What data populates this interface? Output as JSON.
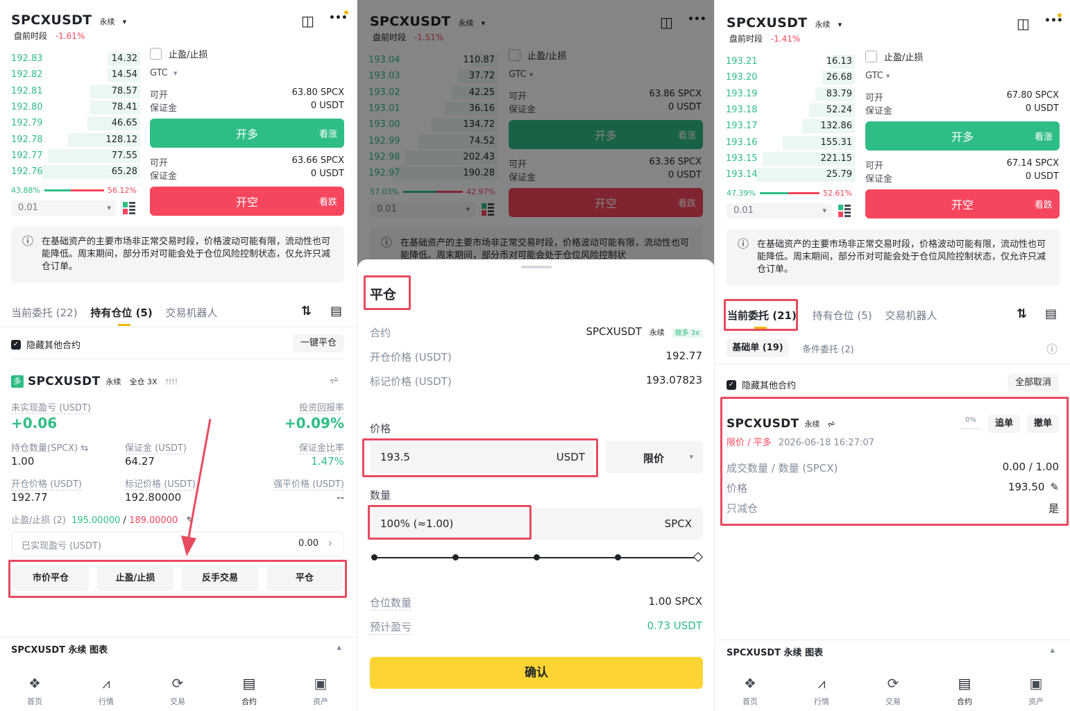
{
  "p1": {
    "symbol": "SPCXUSDT",
    "type": "永续",
    "session": "盘前时段",
    "change": "-1.61%",
    "orderbook": [
      [
        "192.83",
        "14.32"
      ],
      [
        "192.82",
        "14.54"
      ],
      [
        "192.81",
        "78.57"
      ],
      [
        "192.80",
        "78.41"
      ],
      [
        "192.79",
        "46.65"
      ],
      [
        "192.78",
        "128.12"
      ],
      [
        "192.77",
        "77.55"
      ],
      [
        "192.76",
        "65.28"
      ]
    ],
    "depth": [
      0.25,
      0.25,
      0.38,
      0.38,
      0.4,
      0.55,
      0.7,
      0.75
    ],
    "tpsl": "止盈/止损",
    "tif": "GTC",
    "open1_label": "可开",
    "open1_val": "63.80 SPCX",
    "margin1_label": "保证金",
    "margin1_val": "0 USDT",
    "long_btn": "开多",
    "long_sub": "看涨",
    "open2_label": "可开",
    "open2_val": "63.66 SPCX",
    "margin2_label": "保证金",
    "margin2_val": "0 USDT",
    "short_btn": "开空",
    "short_sub": "看跌",
    "ratio_buy": "43.88%",
    "ratio_sell": "56.12%",
    "ratio_buy_frac": 0.4388,
    "step": "0.01",
    "notice": "在基础资产的主要市场非正常交易时段，价格波动可能有限，流动性也可能降低。周末期间，部分币对可能会处于仓位风险控制状态，仅允许只减仓订单。",
    "tabs": [
      "当前委托 (22)",
      "持有仓位 (5)",
      "交易机器人"
    ],
    "hide_other": "隐藏其他合约",
    "close_all": "一键平仓",
    "pos": {
      "symbol": "SPCXUSDT",
      "type": "永续",
      "mode": "全仓 3X",
      "bars": "!!!!",
      "upnl_label": "未实现盈亏 (USDT)",
      "upnl": "+0.06",
      "roi_label": "投资回报率",
      "roi": "+0.09%",
      "qty_label": "持仓数量(SPCX) ⇆",
      "qty": "1.00",
      "margin_label": "保证金 (USDT)",
      "margin": "64.27",
      "mr_label": "保证金比率",
      "mr": "1.47%",
      "entry_label": "开仓价格 (USDT)",
      "entry": "192.77",
      "mark_label": "标记价格 (USDT)",
      "mark": "192.80000",
      "liq_label": "强平价格 (USDT)",
      "liq": "--",
      "tpsl_label": "止盈/止损 (2)",
      "tp": "195.00000",
      "sep": "/",
      "sl": "189.00000",
      "rpnl_label": "已实现盈亏 (USDT)",
      "rpnl": "0.00"
    },
    "actions": [
      "市价平仓",
      "止盈/止损",
      "反手交易",
      "平仓"
    ],
    "chart_bar": "SPCXUSDT 永续 图表"
  },
  "p2": {
    "symbol": "SPCXUSDT",
    "type": "永续",
    "session": "盘前时段",
    "change": "-1.51%",
    "orderbook": [
      [
        "193.04",
        "110.87"
      ],
      [
        "193.03",
        "37.72"
      ],
      [
        "193.02",
        "42.25"
      ],
      [
        "193.01",
        "36.16"
      ],
      [
        "193.00",
        "134.72"
      ],
      [
        "192.99",
        "74.52"
      ],
      [
        "192.98",
        "202.43"
      ],
      [
        "192.97",
        "190.28"
      ]
    ],
    "depth": [
      0.2,
      0.3,
      0.35,
      0.4,
      0.5,
      0.6,
      0.7,
      0.8
    ],
    "tpsl": "止盈/止损",
    "tif": "GTC",
    "open1_label": "可开",
    "open1_val": "63.86 SPCX",
    "margin1_label": "保证金",
    "margin1_val": "0 USDT",
    "long_btn": "开多",
    "long_sub": "看涨",
    "open2_label": "可开",
    "open2_val": "63.36 SPCX",
    "margin2_label": "保证金",
    "margin2_val": "0 USDT",
    "short_btn": "开空",
    "short_sub": "看跌",
    "ratio_buy": "57.03%",
    "ratio_sell": "42.97%",
    "ratio_buy_frac": 0.5703,
    "step": "0.01",
    "notice": "在基础资产的主要市场非正常交易时段，价格波动可能有限，流动性也可能降低。周末期间，部分币对可能会处于仓位风险控制状",
    "sheet": {
      "title": "平仓",
      "contract_label": "合约",
      "contract": "SPCXUSDT",
      "contract_type": "永续",
      "contract_tag": "做多 3x",
      "entry_label": "开仓价格 (USDT)",
      "entry": "192.77",
      "mark_label": "标记价格 (USDT)",
      "mark": "193.07823",
      "price_label": "价格",
      "price": "193.5",
      "price_unit": "USDT",
      "order_type": "限价",
      "qty_label": "数量",
      "qty": "100% (≈1.00)",
      "qty_unit": "SPCX",
      "pos_label": "仓位数量",
      "pos": "1.00 SPCX",
      "pnl_label": "预计盈亏",
      "pnl": "0.73 USDT",
      "confirm": "确认"
    }
  },
  "p3": {
    "symbol": "SPCXUSDT",
    "type": "永续",
    "session": "盘前时段",
    "change": "-1.41%",
    "orderbook": [
      [
        "193.21",
        "16.13"
      ],
      [
        "193.20",
        "26.68"
      ],
      [
        "193.19",
        "83.79"
      ],
      [
        "193.18",
        "52.24"
      ],
      [
        "193.17",
        "132.86"
      ],
      [
        "193.16",
        "155.31"
      ],
      [
        "193.15",
        "221.15"
      ],
      [
        "193.14",
        "25.79"
      ]
    ],
    "depth": [
      0.2,
      0.25,
      0.3,
      0.35,
      0.4,
      0.55,
      0.7,
      0.75
    ],
    "tpsl": "止盈/止损",
    "tif": "GTC",
    "open1_label": "可开",
    "open1_val": "67.80 SPCX",
    "margin1_label": "保证金",
    "margin1_val": "0 USDT",
    "long_btn": "开多",
    "long_sub": "看涨",
    "open2_label": "可开",
    "open2_val": "67.14 SPCX",
    "margin2_label": "保证金",
    "margin2_val": "0 USDT",
    "short_btn": "开空",
    "short_sub": "看跌",
    "ratio_buy": "47.39%",
    "ratio_sell": "52.61%",
    "ratio_buy_frac": 0.4739,
    "step": "0.01",
    "notice": "在基础资产的主要市场非正常交易时段，价格波动可能有限，流动性也可能降低。周末期间，部分币对可能会处于仓位风险控制状态，仅允许只减仓订单。",
    "tabs": [
      "当前委托 (21)",
      "持有仓位 (5)",
      "交易机器人"
    ],
    "subtabs": [
      "基础单 (19)",
      "条件委托 (2)"
    ],
    "hide_other": "隐藏其他合约",
    "cancel_all": "全部取消",
    "order": {
      "symbol": "SPCXUSDT",
      "type": "永续",
      "fill_pct": "0%",
      "chase": "追单",
      "cancel": "撤单",
      "kind": "限价 / 平多",
      "time": "2026-06-18 16:27:07",
      "filled_label": "成交数量 / 数量 (SPCX)",
      "filled": "0.00 / 1.00",
      "price_label": "价格",
      "price": "193.50",
      "ro_label": "只减仓",
      "ro": "是"
    },
    "chart_bar": "SPCXUSDT 永续 图表"
  },
  "nav": [
    "首页",
    "行情",
    "交易",
    "合约",
    "资产"
  ],
  "icons": {
    "candle": "◫",
    "more": "•••",
    "info": "ⓘ",
    "share": "⩫",
    "sort": "⇅",
    "doc": "▤",
    "edit": "✎",
    "pen": "✎",
    "chevron": "▾",
    "arrow": "›",
    "check": "✓",
    "up": "▴"
  },
  "colors": {
    "green": "#2ebd85",
    "red": "#f6465d",
    "yellow": "#fcd535",
    "highlight": "#e84a5f"
  }
}
